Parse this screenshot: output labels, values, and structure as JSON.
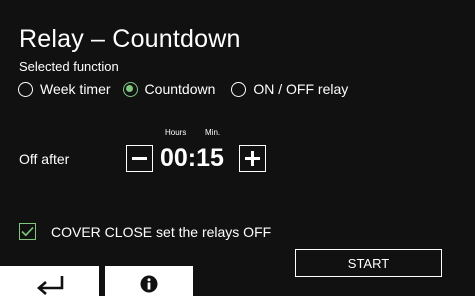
{
  "header": {
    "title": "Relay – Countdown",
    "subtitle": "Selected function"
  },
  "functions": {
    "options": [
      {
        "label": "Week timer",
        "selected": false
      },
      {
        "label": "Countdown",
        "selected": true
      },
      {
        "label": "ON / OFF relay",
        "selected": false
      }
    ]
  },
  "timer": {
    "hours_label": "Hours",
    "min_label": "Min.",
    "off_after_label": "Off after",
    "value": "00:15"
  },
  "cover_option": {
    "label": "COVER CLOSE set the relays OFF",
    "checked": true
  },
  "buttons": {
    "start_label": "START",
    "back_icon": "return-arrow-icon",
    "info_icon": "info-icon"
  },
  "colors": {
    "background": "#111111",
    "accent": "#7ec87e",
    "foreground": "#ffffff"
  }
}
